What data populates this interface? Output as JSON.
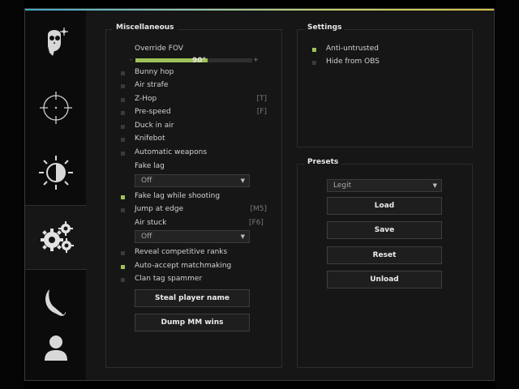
{
  "colors": {
    "accent": "#9fc15a",
    "window_bg": "#161616",
    "sidebar_bg": "#0b0b0b"
  },
  "sidebar": {
    "tabs": [
      {
        "icon": "skull-aim-icon",
        "active": false
      },
      {
        "icon": "crosshair-icon",
        "active": false
      },
      {
        "icon": "brightness-icon",
        "active": false
      },
      {
        "icon": "gears-icon",
        "active": true
      },
      {
        "icon": "knife-icon",
        "active": false
      },
      {
        "icon": "user-icon",
        "active": false
      }
    ]
  },
  "misc": {
    "title": "Miscellaneous",
    "fov": {
      "label": "Override FOV",
      "value": "90°",
      "minus": "-",
      "plus": "+",
      "fill_fraction": 0.62
    },
    "items": [
      {
        "label": "Bunny hop",
        "checked": false,
        "hotkey": ""
      },
      {
        "label": "Air strafe",
        "checked": false,
        "hotkey": ""
      },
      {
        "label": "Z-Hop",
        "checked": false,
        "hotkey": "[T]"
      },
      {
        "label": "Pre-speed",
        "checked": false,
        "hotkey": "[F]"
      },
      {
        "label": "Duck in air",
        "checked": false,
        "hotkey": ""
      },
      {
        "label": "Knifebot",
        "checked": false,
        "hotkey": ""
      },
      {
        "label": "Automatic weapons",
        "checked": false,
        "hotkey": ""
      }
    ],
    "fake_lag": {
      "label": "Fake lag",
      "value": "Off",
      "arrow": "▼"
    },
    "items2": [
      {
        "label": "Fake lag while shooting",
        "checked": true,
        "hotkey": ""
      },
      {
        "label": "Jump at edge",
        "checked": false,
        "hotkey": "[M5]"
      }
    ],
    "air_stuck": {
      "label": "Air stuck",
      "hotkey": "[F6]",
      "value": "Off",
      "arrow": "▼"
    },
    "items3": [
      {
        "label": "Reveal competitive ranks",
        "checked": false
      },
      {
        "label": "Auto-accept matchmaking",
        "checked": true
      },
      {
        "label": "Clan tag spammer",
        "checked": false
      }
    ],
    "buttons": {
      "steal": "Steal player name",
      "dump": "Dump MM wins"
    }
  },
  "settings": {
    "title": "Settings",
    "items": [
      {
        "label": "Anti-untrusted",
        "checked": true
      },
      {
        "label": "Hide from OBS",
        "checked": false
      }
    ]
  },
  "presets": {
    "title": "Presets",
    "selected": "Legit",
    "arrow": "▼",
    "buttons": {
      "load": "Load",
      "save": "Save",
      "reset": "Reset",
      "unload": "Unload"
    }
  }
}
